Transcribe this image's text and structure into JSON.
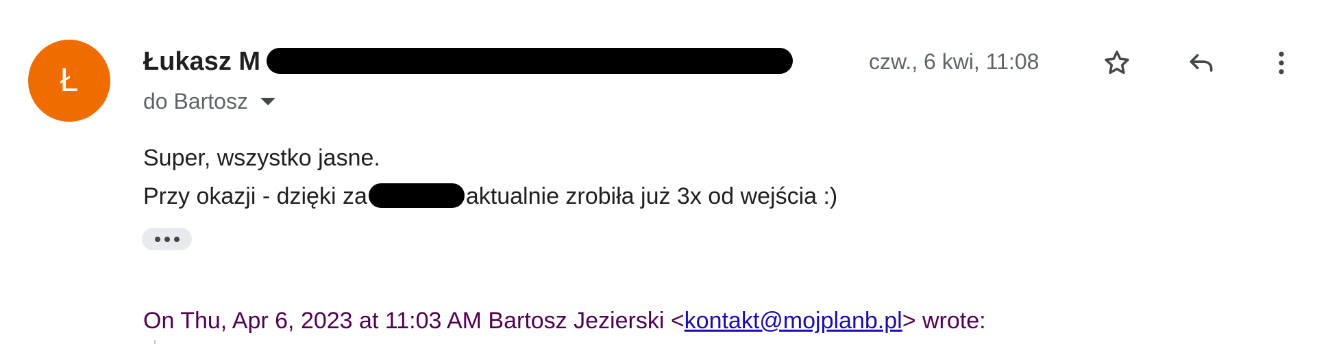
{
  "sender": {
    "avatar_letter": "Ł",
    "avatar_color": "#ef6c00",
    "name": "Łukasz M"
  },
  "recipient": {
    "label": "do Bartosz"
  },
  "date": "czw., 6 kwi, 11:08",
  "icons": {
    "star": "star-icon",
    "reply": "reply-icon",
    "more": "more-vert-icon"
  },
  "body": {
    "line1": "Super, wszystko jasne.",
    "line2_before": "Przy okazji - dzięki za",
    "line2_after": "aktualnie zrobiła już 3x od wejścia :)"
  },
  "quote": {
    "prefix": "On Thu, Apr 6, 2023 at 11:03 AM Bartosz Jezierski <",
    "email": "kontakt@mojplanb.pl",
    "suffix": "> wrote:"
  },
  "colors": {
    "quote_text": "#500050",
    "link": "#1a0dab"
  }
}
